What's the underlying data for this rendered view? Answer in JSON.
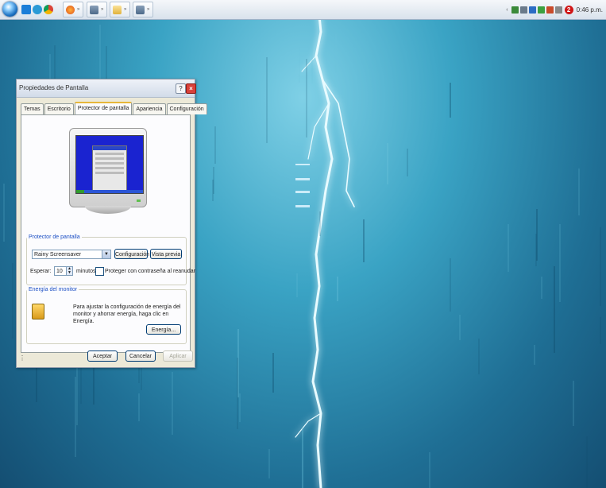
{
  "taskbar": {
    "quick_launch_icons": [
      "media-player-icon",
      "ie-icon",
      "chrome-icon"
    ],
    "buttons": [
      {
        "icon": "firefox-icon",
        "label": "»"
      },
      {
        "icon": "tool-icon",
        "label": "»"
      },
      {
        "icon": "folder-icon",
        "label": "»"
      },
      {
        "icon": "tool-icon",
        "label": "»"
      }
    ],
    "tray": {
      "notification_count": "2",
      "clock": "0:46 p.m."
    }
  },
  "dialog": {
    "title": "Propiedades de Pantalla",
    "help_glyph": "?",
    "close_glyph": "×",
    "tabs": [
      "Temas",
      "Escritorio",
      "Protector de pantalla",
      "Apariencia",
      "Configuración"
    ],
    "active_tab": 2,
    "screensaver": {
      "group_label": "Protector de pantalla",
      "selected": "Rainy Screensaver",
      "settings_button": "Configuración",
      "preview_button": "Vista previa",
      "wait_label": "Esperar:",
      "wait_value": "10",
      "minutes_label": "minutos",
      "password_label": "Proteger con contraseña al reanudar",
      "password_checked": false
    },
    "energy": {
      "group_label": "Energía del monitor",
      "description": "Para ajustar la configuración de energía del monitor y ahorrar energía, haga clic en Energía.",
      "button": "Energía..."
    },
    "footer": {
      "ok": "Aceptar",
      "cancel": "Cancelar",
      "apply": "Aplicar"
    }
  },
  "colors": {
    "desktop_top": "#7fd0e6",
    "desktop_bottom": "#144e72",
    "lightning": "#e8fbff",
    "group_label": "#1c4fc4",
    "preview_screen": "#1a23d0"
  }
}
